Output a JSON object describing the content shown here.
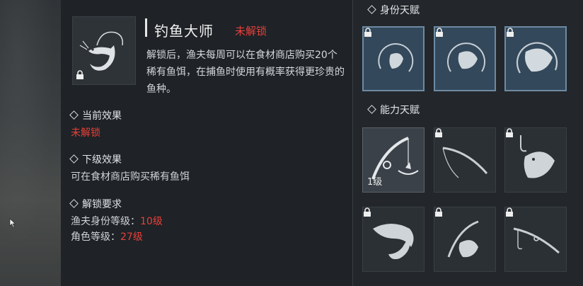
{
  "skill": {
    "name": "钓鱼大师",
    "status": "未解锁",
    "description": "解锁后，渔夫每周可以在食材商店购买20个稀有鱼饵，在捕鱼时使用有概率获得更珍贵的鱼种。",
    "icon": "shrimp-hook-icon"
  },
  "sections": {
    "current_effect": {
      "title": "当前效果",
      "value": "未解锁"
    },
    "next_effect": {
      "title": "下级效果",
      "value": "可在食材商店购买稀有鱼饵"
    },
    "requirements": {
      "title": "解锁要求",
      "items": [
        {
          "label": "渔夫身份等级：",
          "value": "10级"
        },
        {
          "label": "角色等级：",
          "value": "27级"
        }
      ]
    }
  },
  "talents": {
    "identity_title": "身份天赋",
    "ability_title": "能力天赋",
    "identity_slots": [
      {
        "icon": "fish-hook-icon",
        "locked": true
      },
      {
        "icon": "fish-hook-icon",
        "locked": true
      },
      {
        "icon": "big-fish-hook-icon",
        "locked": true
      }
    ],
    "ability_slots": [
      {
        "icon": "fishing-rod-icon",
        "locked": false,
        "level": "1级"
      },
      {
        "icon": "rod-icon",
        "locked": true
      },
      {
        "icon": "hooked-fish-icon",
        "locked": true
      },
      {
        "icon": "shrimp-icon",
        "locked": true
      },
      {
        "icon": "rod-fish-icon",
        "locked": true
      },
      {
        "icon": "rod-line-icon",
        "locked": true
      }
    ]
  },
  "colors": {
    "locked_red": "#e8403a",
    "identity_border": "#6d8aa3"
  }
}
